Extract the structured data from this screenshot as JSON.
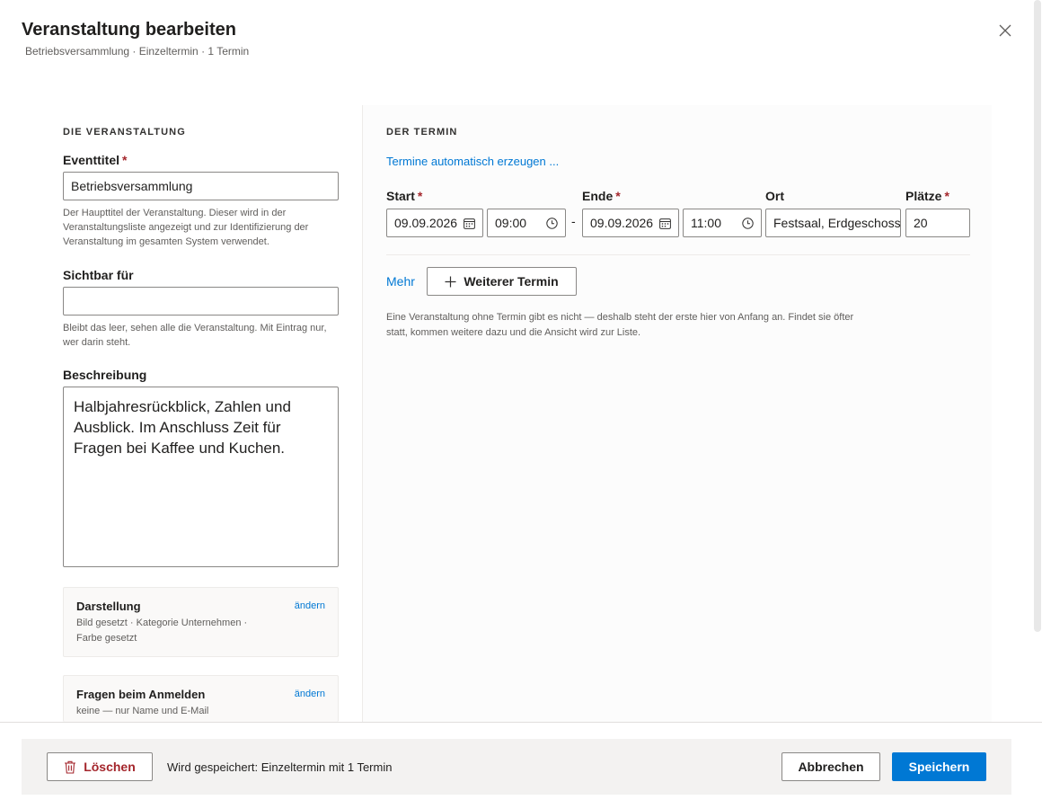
{
  "header": {
    "title": "Veranstaltung bearbeiten",
    "subtitle": "Betriebsversammlung · Einzeltermin · 1 Termin"
  },
  "event": {
    "section_title": "DIE VERANSTALTUNG",
    "title_label": "Eventtitel",
    "required_mark": "*",
    "title_value": "Betriebsversammlung",
    "title_help": "Der Haupttitel der Veranstaltung. Dieser wird in der Veranstaltungsliste angezeigt und zur Identifizierung der Veranstaltung im gesamten System verwendet.",
    "visible_label": "Sichtbar für",
    "visible_value": "",
    "visible_help": "Bleibt das leer, sehen alle die Veranstaltung. Mit Eintrag nur, wer darin steht.",
    "description_label": "Beschreibung",
    "description_value": "Halbjahresrückblick, Zahlen und Ausblick. Im Anschluss Zeit für Fragen bei Kaffee und Kuchen.",
    "cards": [
      {
        "title": "Darstellung",
        "text": "Bild gesetzt · Kategorie Unternehmen · Farbe gesetzt",
        "link": "ändern"
      },
      {
        "title": "Fragen beim Anmelden",
        "text": "keine — nur Name und E-Mail",
        "link": "ändern"
      }
    ]
  },
  "termin": {
    "section_title": "DER TERMIN",
    "auto_link": "Termine automatisch erzeugen ...",
    "start_label": "Start",
    "end_label": "Ende",
    "location_label": "Ort",
    "seats_label": "Plätze",
    "required_mark": "*",
    "start_date": "09.09.2026",
    "start_time": "09:00",
    "separator": "-",
    "end_date": "09.09.2026",
    "end_time": "11:00",
    "location": "Festsaal, Erdgeschoss",
    "seats": "20",
    "more_link": "Mehr",
    "add_button": "Weiterer Termin",
    "info": "Eine Veranstaltung ohne Termin gibt es nicht — deshalb steht der erste hier von Anfang an. Findet sie öfter statt, kommen weitere dazu und die Ansicht wird zur Liste."
  },
  "footer": {
    "delete_label": "Löschen",
    "status": "Wird gespeichert: Einzeltermin mit 1 Termin",
    "cancel_label": "Abbrechen",
    "save_label": "Speichern"
  },
  "colors": {
    "accent": "#0078d4",
    "danger": "#a4262c"
  },
  "icons": [
    "close-icon",
    "calendar-icon",
    "clock-icon",
    "plus-icon",
    "trash-icon"
  ]
}
